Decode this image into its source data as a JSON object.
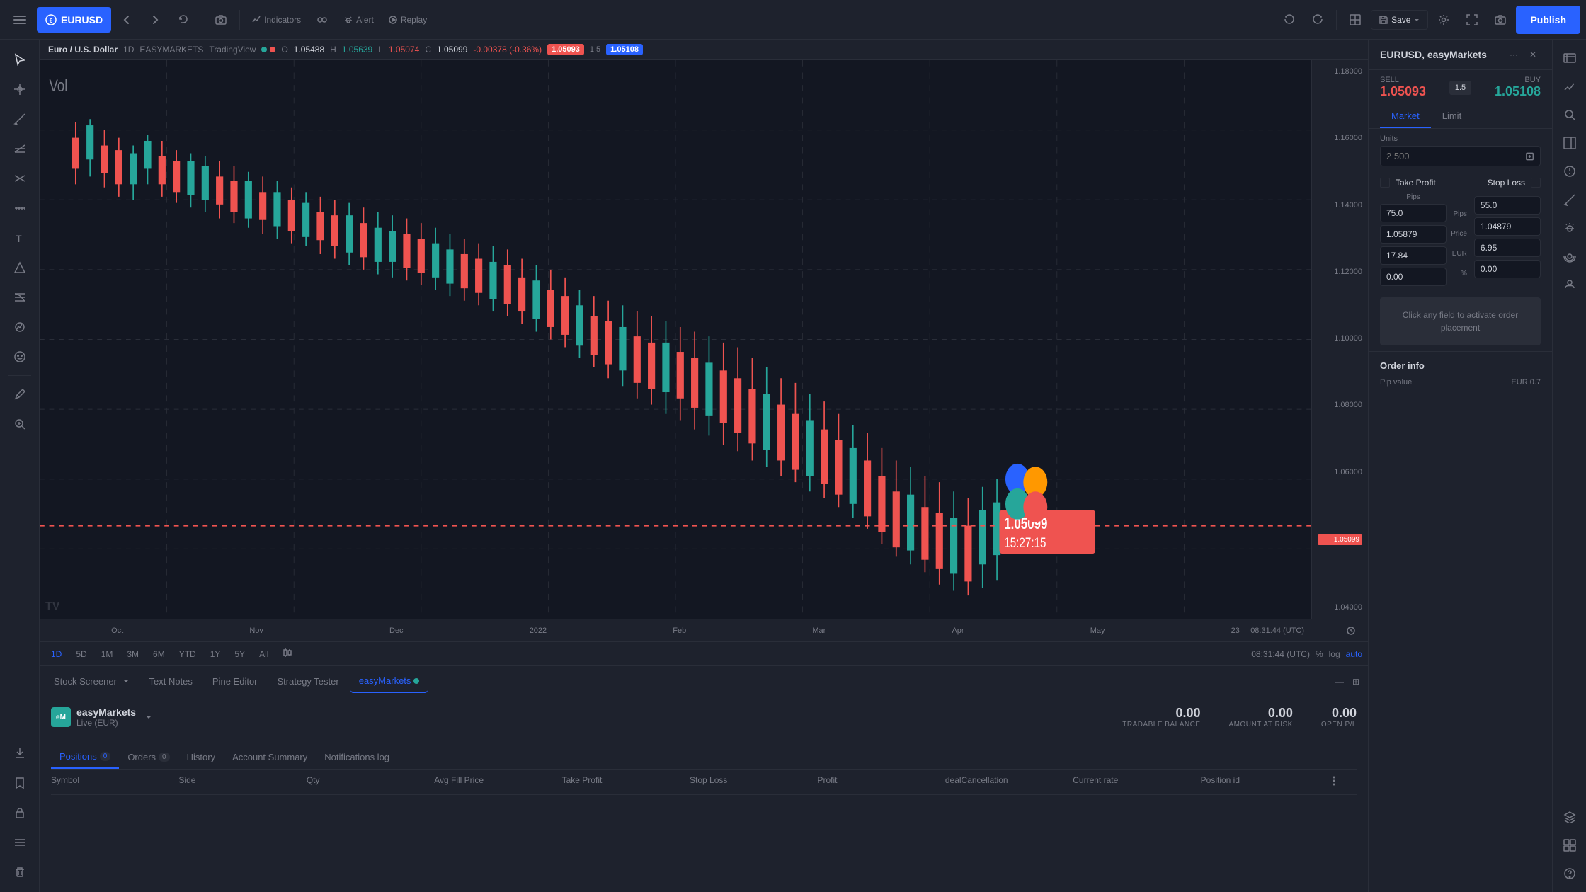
{
  "topbar": {
    "symbol": "EURUSD",
    "back_label": "←",
    "indicators_label": "Indicators",
    "alert_label": "Alert",
    "replay_label": "Replay",
    "save_label": "Save",
    "publish_label": "Publish"
  },
  "chart_header": {
    "symbol": "Euro / U.S. Dollar",
    "interval": "1D",
    "exchange": "EASYMARKETS",
    "platform": "TradingView",
    "o_label": "O",
    "o_value": "1.05488",
    "h_label": "H",
    "h_value": "1.05639",
    "l_label": "L",
    "l_value": "1.05074",
    "c_label": "C",
    "c_value": "1.05099",
    "change": "-0.00378 (-0.36%)",
    "bid_price": "1.05093",
    "ask_price": "1.05108"
  },
  "price_axis": {
    "levels": [
      "1.18000",
      "1.16000",
      "1.14000",
      "1.12000",
      "1.10000",
      "1.08000",
      "1.06000",
      "1.04000"
    ],
    "current": "1.05099"
  },
  "time_axis": {
    "labels": [
      "Oct",
      "Nov",
      "Dec",
      "2022",
      "Feb",
      "Mar",
      "Apr",
      "May",
      "23"
    ],
    "datetime": "08:31:44 (UTC)"
  },
  "intervals": {
    "items": [
      "1D",
      "5D",
      "1M",
      "3M",
      "6M",
      "YTD",
      "1Y",
      "5Y",
      "All"
    ],
    "active": "1D",
    "extra_btn": "⊞"
  },
  "chart_options": {
    "percent": "%",
    "log": "log",
    "auto": "auto"
  },
  "bottom_tabs": {
    "items": [
      "Stock Screener",
      "Text Notes",
      "Pine Editor",
      "Strategy Tester",
      "easyMarkets"
    ],
    "active": "easyMarkets",
    "easy_markets_dot": true
  },
  "easy_markets_panel": {
    "logo_text": "eM",
    "name": "easyMarkets",
    "currency": "Live (EUR)",
    "tradable_balance": "0.00",
    "amount_at_risk": "0.00",
    "open_pl": "0.00",
    "tradable_label": "TRADABLE BALANCE",
    "risk_label": "AMOUNT AT RISK",
    "pl_label": "OPEN P/L"
  },
  "sub_tabs": {
    "items": [
      "Positions",
      "Orders",
      "History",
      "Account Summary",
      "Notifications log"
    ],
    "active": "Positions",
    "positions_count": "0",
    "orders_count": "0"
  },
  "table_columns": {
    "headers": [
      "Symbol",
      "Side",
      "Qty",
      "Avg Fill Price",
      "Take Profit",
      "Stop Loss",
      "Profit",
      "dealCancellation",
      "Current rate",
      "Position id"
    ]
  },
  "trade_panel": {
    "title": "EURUSD, easyMarkets",
    "sell_label": "SELL",
    "buy_label": "BUY",
    "sell_price": "1.05093",
    "buy_price": "1.05108",
    "spread": "1.5",
    "market_tab": "Market",
    "limit_tab": "Limit",
    "units_label": "Units",
    "units_placeholder": "2 500",
    "take_profit_label": "Take Profit",
    "stop_loss_label": "Stop Loss",
    "tp_pips_label": "Pips",
    "tp_price_label": "Price",
    "tp_eur_label": "EUR",
    "tp_pct_label": "%",
    "tp_pips_value": "75.0",
    "tp_price_value": "1.05879",
    "tp_eur_value": "17.84",
    "tp_pct_value": "0.00",
    "sl_pips_value": "55.0",
    "sl_price_value": "1.04879",
    "sl_eur_value": "6.95",
    "sl_pct_value": "0.00",
    "activate_text": "Click any field to activate order placement",
    "order_info_title": "Order info",
    "pip_value_label": "Pip value",
    "pip_value": "EUR 0.7"
  }
}
